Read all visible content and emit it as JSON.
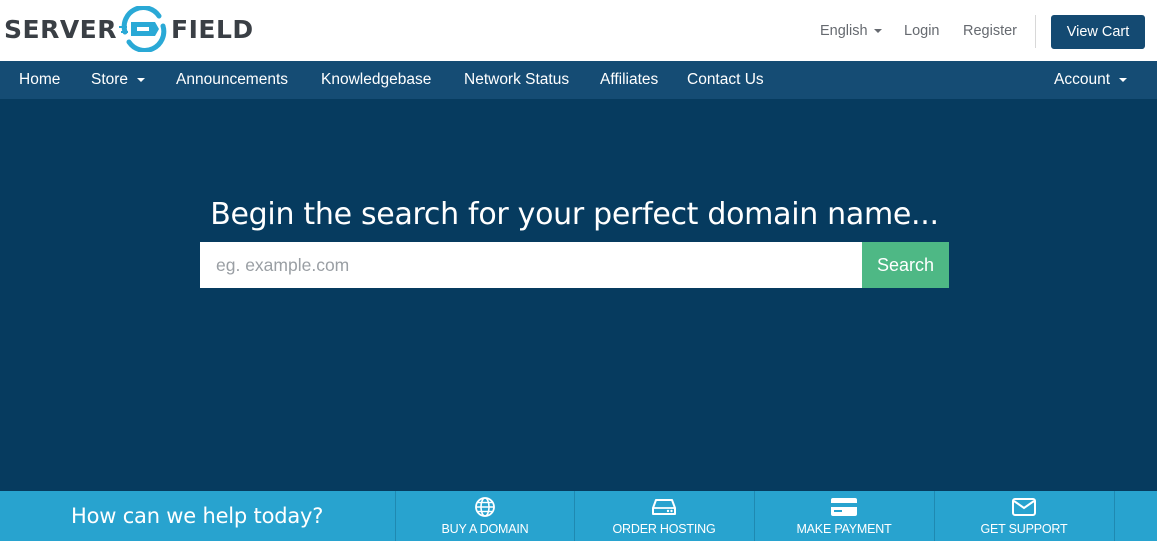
{
  "header": {
    "language": "English",
    "login": "Login",
    "register": "Register",
    "cart": "View Cart"
  },
  "logo": {
    "left": "SERVER",
    "right": "FIELD",
    "accent_color": "#2aa9d6"
  },
  "nav": {
    "home": "Home",
    "store": "Store",
    "announcements": "Announcements",
    "knowledgebase": "Knowledgebase",
    "network_status": "Network Status",
    "affiliates": "Affiliates",
    "contact": "Contact Us",
    "account": "Account"
  },
  "hero": {
    "title": "Begin the search for your perfect domain name...",
    "search_placeholder": "eg. example.com",
    "search_button": "Search"
  },
  "help": {
    "title": "How can we help today?",
    "actions": [
      {
        "label": "BUY A DOMAIN",
        "icon": "globe-icon"
      },
      {
        "label": "ORDER HOSTING",
        "icon": "server-icon"
      },
      {
        "label": "MAKE PAYMENT",
        "icon": "credit-card-icon"
      },
      {
        "label": "GET SUPPORT",
        "icon": "envelope-icon"
      }
    ]
  },
  "colors": {
    "topnav": "#154c74",
    "hero": "#063b5f",
    "cart_button": "#144a72",
    "search_button": "#4eb885",
    "helpbar": "#28a3cf"
  }
}
